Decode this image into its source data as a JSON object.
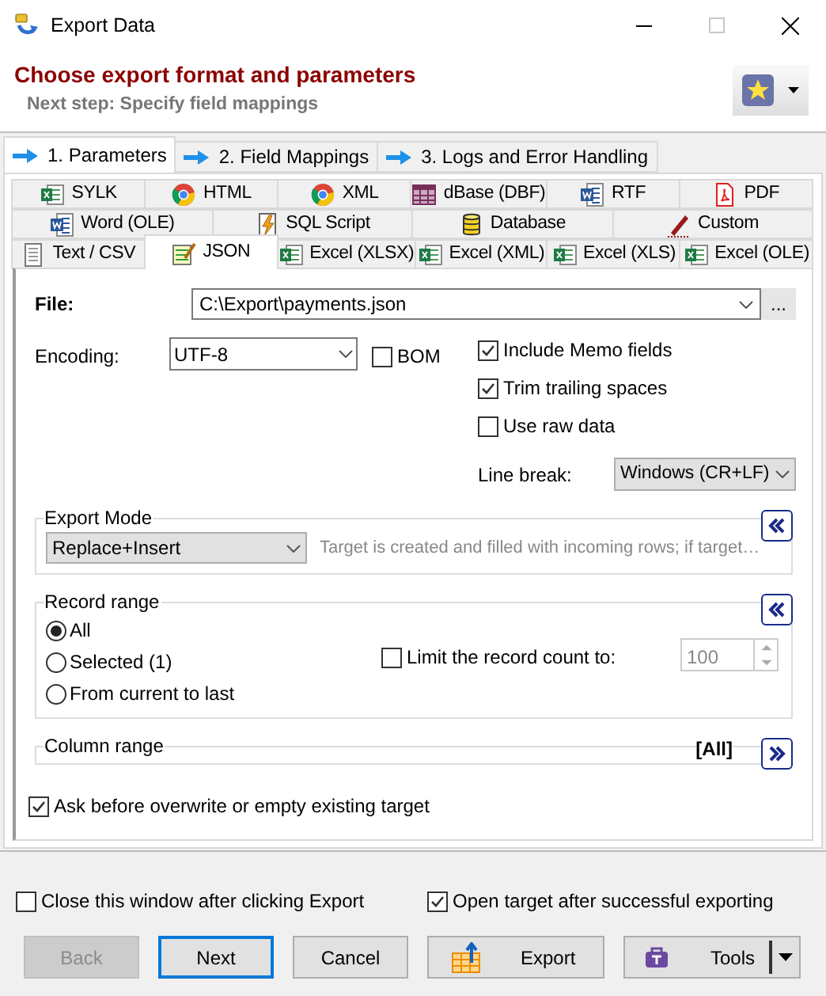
{
  "window": {
    "title": "Export Data"
  },
  "header": {
    "title": "Choose export format and parameters",
    "subtitle": "Next step: Specify field mappings"
  },
  "steps": [
    {
      "label": "1. Parameters",
      "selected": true
    },
    {
      "label": "2. Field Mappings",
      "selected": false
    },
    {
      "label": "3. Logs and Error Handling",
      "selected": false
    }
  ],
  "format_tab_rows": [
    {
      "tabs": [
        {
          "label": "SYLK",
          "kind": "sheet",
          "selected": false
        },
        {
          "label": "HTML",
          "kind": "browser",
          "selected": false
        },
        {
          "label": "XML",
          "kind": "browser",
          "selected": false
        },
        {
          "label": "dBase (DBF)",
          "kind": "grid",
          "selected": false
        },
        {
          "label": "RTF",
          "kind": "word",
          "selected": false
        },
        {
          "label": "PDF",
          "kind": "pdf",
          "selected": false
        }
      ]
    },
    {
      "tabs": [
        {
          "label": "Word (OLE)",
          "kind": "word",
          "selected": false
        },
        {
          "label": "SQL Script",
          "kind": "script",
          "selected": false
        },
        {
          "label": "Database",
          "kind": "database",
          "selected": false
        },
        {
          "label": "Custom",
          "kind": "pen",
          "selected": false
        }
      ]
    },
    {
      "tabs": [
        {
          "label": "Text / CSV",
          "kind": "text",
          "selected": false
        },
        {
          "label": "JSON",
          "kind": "notepad",
          "selected": true
        },
        {
          "label": "Excel (XLSX)",
          "kind": "sheet",
          "selected": false
        },
        {
          "label": "Excel (XML)",
          "kind": "sheet",
          "selected": false
        },
        {
          "label": "Excel (XLS)",
          "kind": "sheet",
          "selected": false
        },
        {
          "label": "Excel (OLE)",
          "kind": "sheet",
          "selected": false
        }
      ]
    }
  ],
  "file": {
    "label": "File:",
    "value": "C:\\Export\\payments.json",
    "browse": "..."
  },
  "encoding": {
    "label": "Encoding:",
    "value": "UTF-8"
  },
  "bom": {
    "label": "BOM",
    "checked": false
  },
  "options": [
    {
      "label": "Include Memo fields",
      "checked": true
    },
    {
      "label": "Trim trailing spaces",
      "checked": true
    },
    {
      "label": "Use raw data",
      "checked": false
    }
  ],
  "line_break": {
    "label": "Line break:",
    "value": "Windows (CR+LF)"
  },
  "export_mode": {
    "title": "Export Mode",
    "value": "Replace+Insert",
    "description": "Target is created and filled with incoming rows; if target…",
    "expanded": true
  },
  "record_range": {
    "title": "Record range",
    "expanded": true,
    "options": [
      {
        "label": "All",
        "selected": true
      },
      {
        "label": "Selected (1)",
        "selected": false
      },
      {
        "label": "From current to last",
        "selected": false
      }
    ],
    "limit": {
      "label": "Limit the record count to:",
      "checked": false,
      "value": "100"
    }
  },
  "column_range": {
    "title": "Column range",
    "value": "[All]",
    "expanded": false
  },
  "ask_overwrite": {
    "label": "Ask before overwrite or empty existing target",
    "checked": true
  },
  "footer_options": [
    {
      "label": "Close this window after clicking Export",
      "checked": false
    },
    {
      "label": "Open target after successful exporting",
      "checked": true
    }
  ],
  "buttons": [
    {
      "label": "Back",
      "kind": "plain",
      "disabled": true
    },
    {
      "label": "Next",
      "kind": "default",
      "disabled": false
    },
    {
      "label": "Cancel",
      "kind": "plain",
      "disabled": false
    },
    {
      "label": "Export",
      "kind": "export",
      "disabled": false
    },
    {
      "label": "Tools",
      "kind": "tools",
      "disabled": false
    }
  ]
}
